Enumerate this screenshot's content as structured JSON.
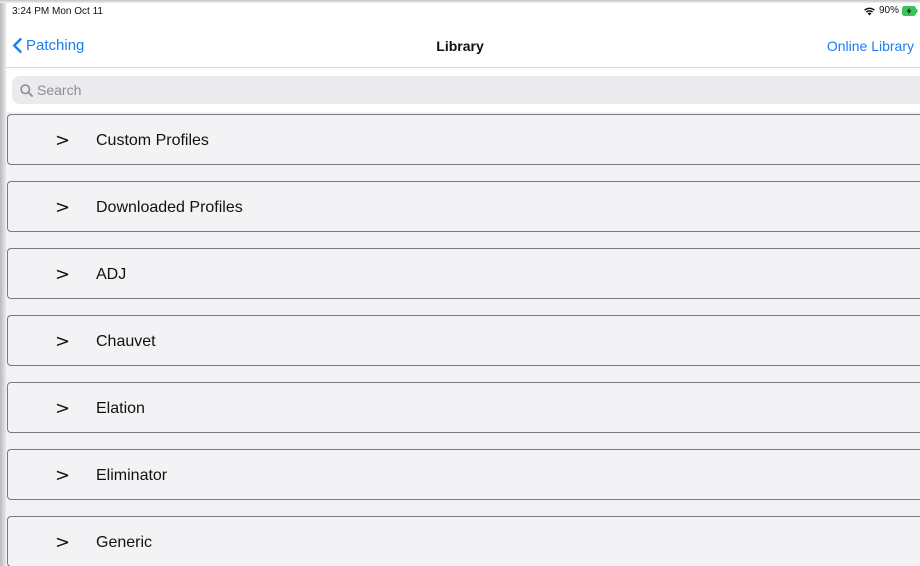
{
  "status_bar": {
    "time": "3:24 PM  Mon Oct 11",
    "battery": "90%",
    "icons": [
      "wifi-icon",
      "battery-charging-icon"
    ]
  },
  "nav": {
    "back_label": "Patching",
    "title": "Library",
    "right_label": "Online Library",
    "accent_color": "#1a7df2"
  },
  "search": {
    "placeholder": "Search",
    "value": ""
  },
  "library": {
    "expand_glyph": ">",
    "items": [
      {
        "label": "Custom Profiles"
      },
      {
        "label": "Downloaded Profiles"
      },
      {
        "label": "ADJ"
      },
      {
        "label": "Chauvet"
      },
      {
        "label": "Elation"
      },
      {
        "label": "Eliminator"
      },
      {
        "label": "Generic"
      }
    ]
  }
}
